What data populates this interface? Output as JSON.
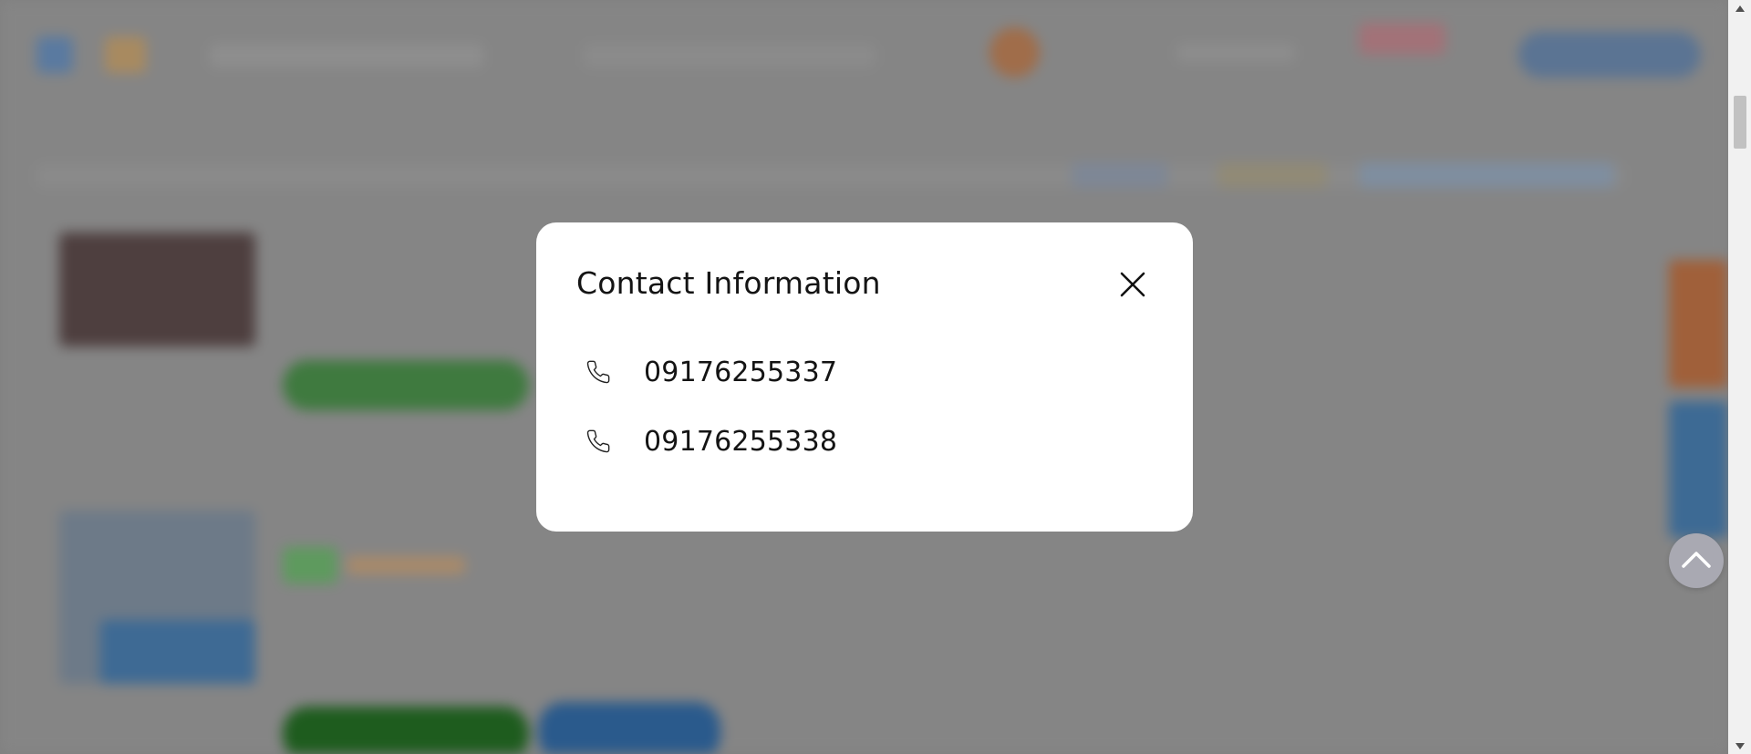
{
  "modal": {
    "title": "Contact Information",
    "close_icon": "close-icon",
    "phones": [
      {
        "icon": "phone-icon",
        "number": "09176255337"
      },
      {
        "icon": "phone-icon",
        "number": "09176255338"
      }
    ]
  },
  "overlay": {
    "color": "#808080"
  },
  "back_to_top": {
    "icon": "chevron-up-icon",
    "color": "#a9a9b2"
  },
  "scrollbar": {
    "icons": [
      "triangle-up-icon",
      "triangle-down-icon"
    ]
  }
}
